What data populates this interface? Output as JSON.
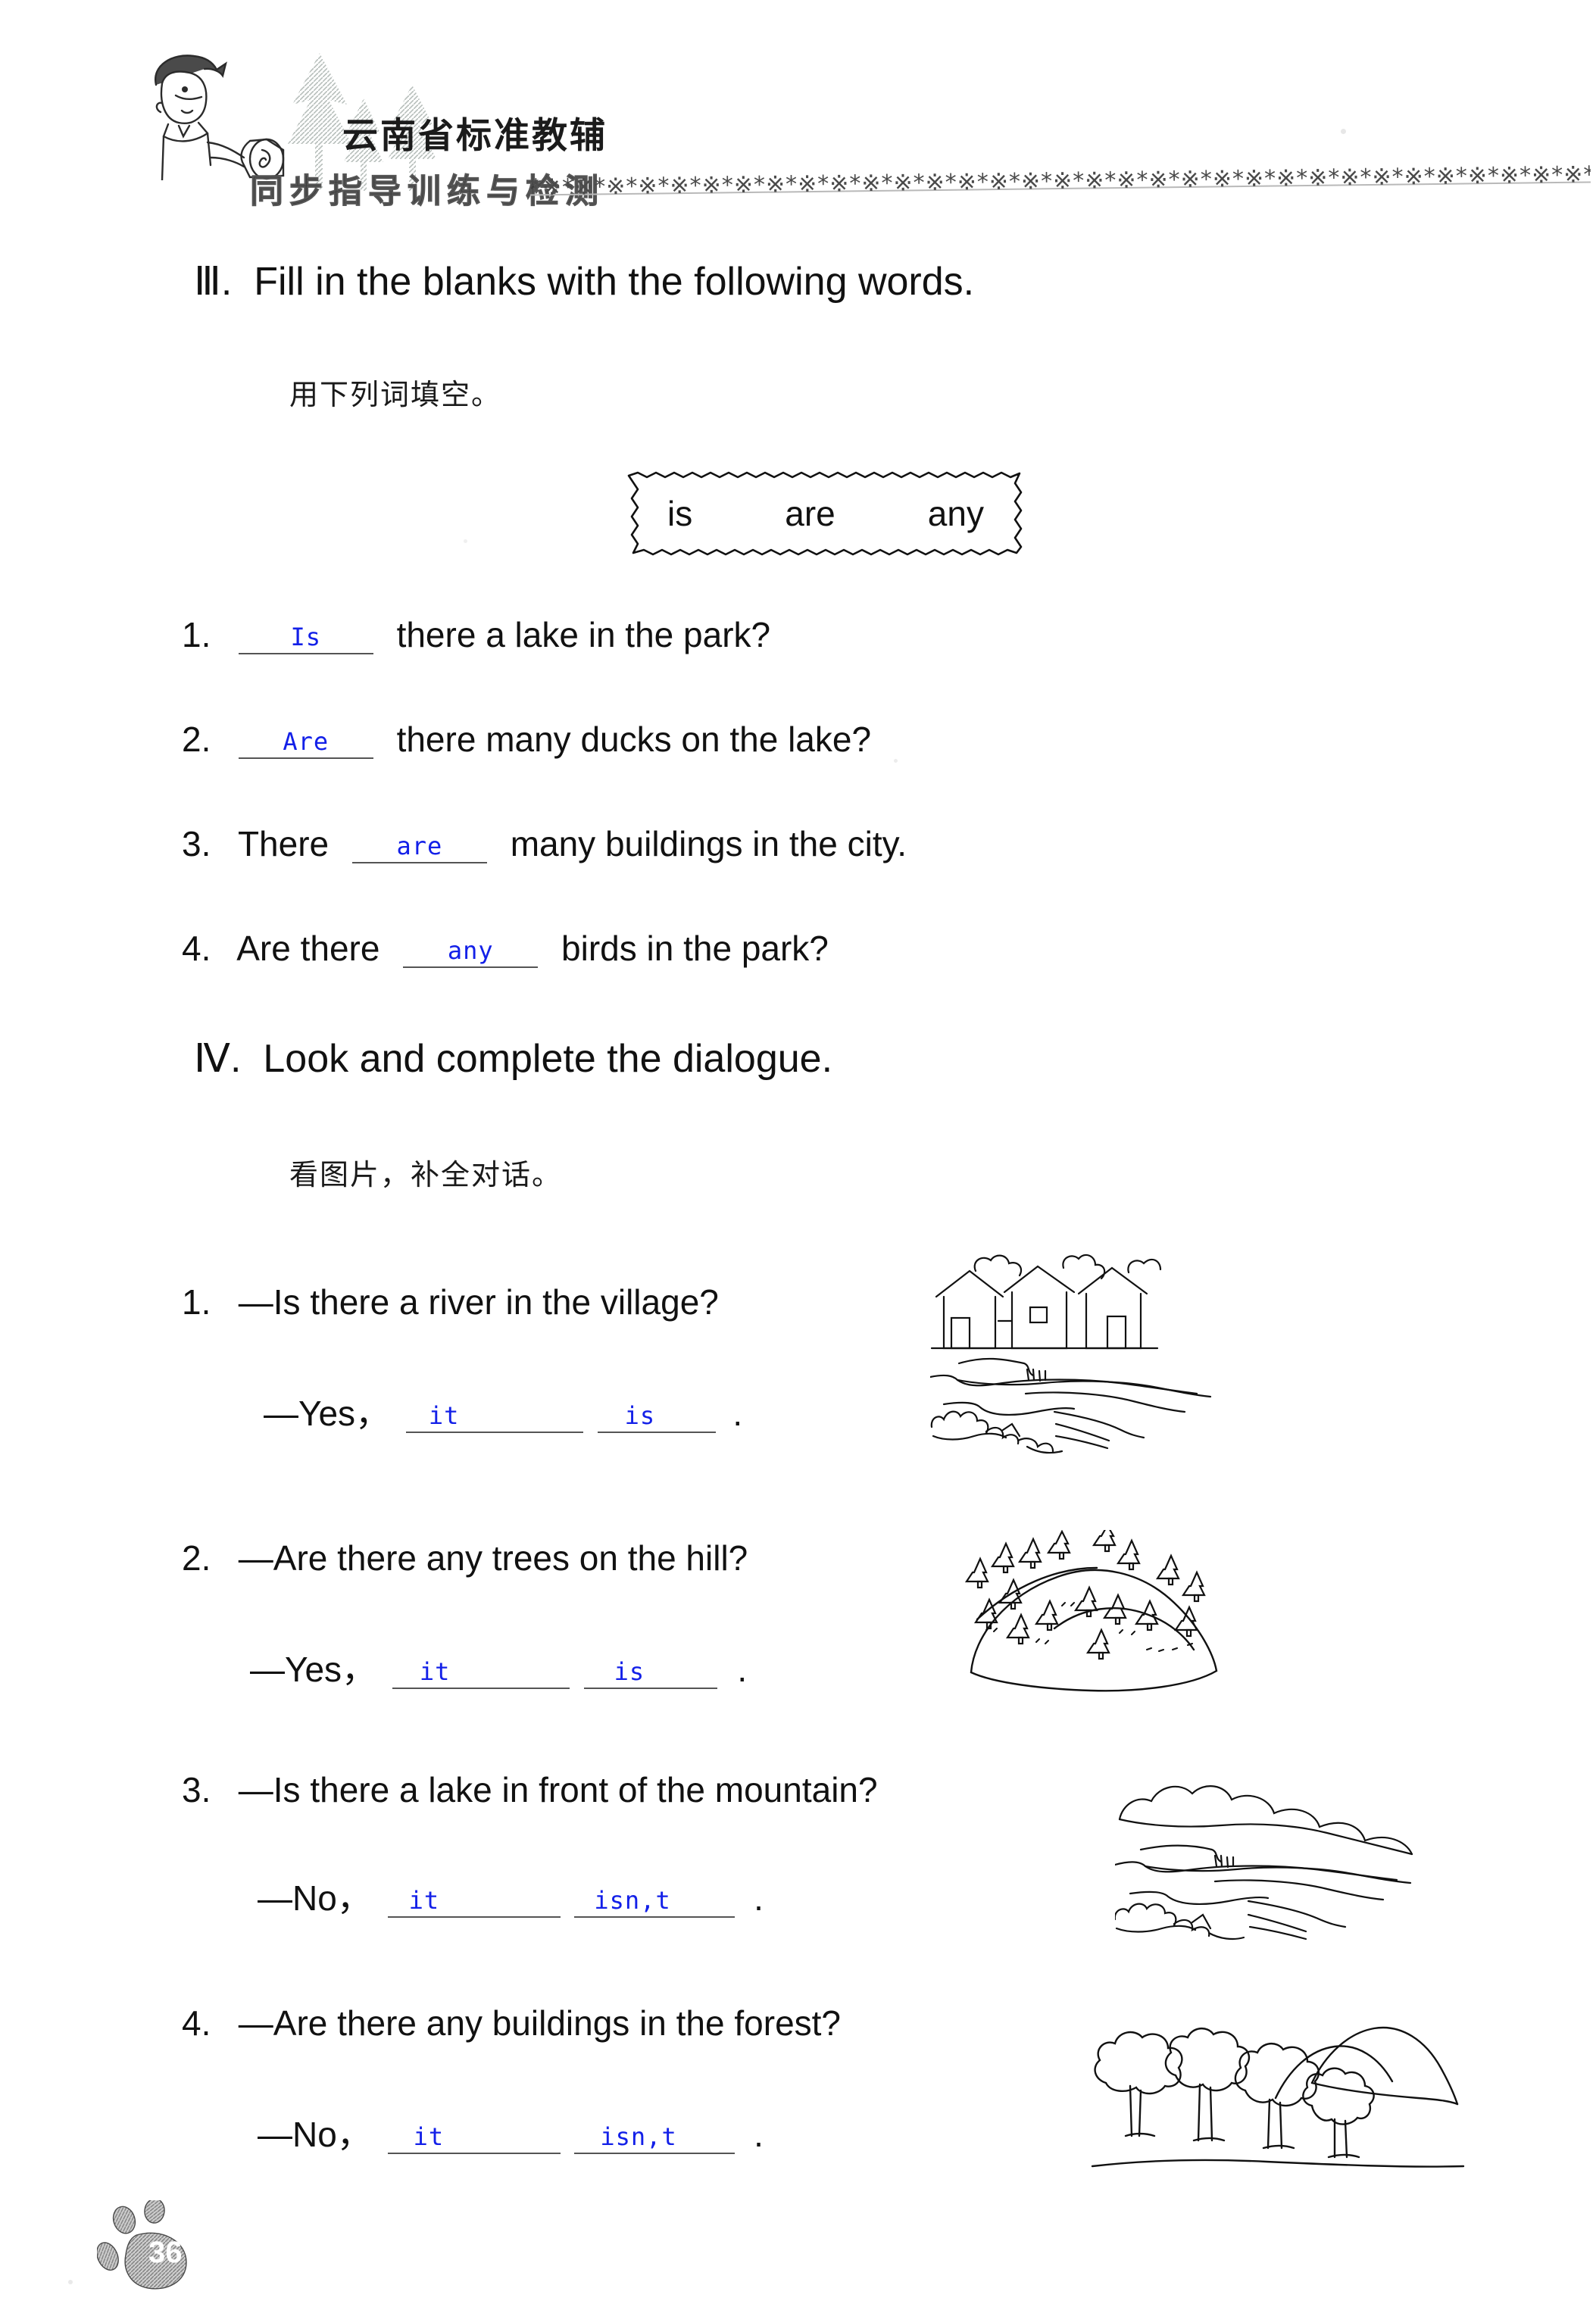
{
  "header": {
    "brand_cn": "云南省标准教辅",
    "brand_sub_cn": "同步指导训练与检测",
    "asterisk_band": "*※*※*※*※*※*※*※*※*※*※*※*※*※*※*※*※*※*※*※*※*※*※*※*※*※*※*※*※*※*※*※*※*※*※*※*※*※*",
    "mascot_icon": "boy-with-scroll-icon",
    "trees_icon": "pine-trees-icon"
  },
  "sections": [
    {
      "roman": "Ⅲ",
      "dot": ".",
      "title": "Fill in the blanks with the following words.",
      "instruction_cn": "用下列词填空。",
      "word_bank": [
        "is",
        "are",
        "any"
      ],
      "items": [
        {
          "num": "1.",
          "before": "",
          "answer": "Is",
          "after": "there a lake in the park?"
        },
        {
          "num": "2.",
          "before": "",
          "answer": "Are",
          "after": "there many ducks on the lake?"
        },
        {
          "num": "3.",
          "before": "There",
          "answer": "are",
          "after": "many buildings in the city."
        },
        {
          "num": "4.",
          "before": "Are there",
          "answer": "any",
          "after": "birds in the park?"
        }
      ]
    },
    {
      "roman": "Ⅳ",
      "dot": ".",
      "title": "Look and complete the dialogue.",
      "instruction_cn": "看图片，补全对话。",
      "items": [
        {
          "num": "1.",
          "question": "—Is there a river in the village?",
          "answer_lead": "—Yes，",
          "answer_1": "it",
          "answer_2": "is",
          "period": ".",
          "picture": "village-with-river-icon"
        },
        {
          "num": "2.",
          "question": "—Are there any trees on the hill?",
          "answer_lead": "—Yes，",
          "answer_1": "it",
          "answer_2": "is",
          "period": ".",
          "picture": "hill-with-trees-icon"
        },
        {
          "num": "3.",
          "question": "—Is there a lake in front of the mountain?",
          "answer_lead": "—No，",
          "answer_1": "it",
          "answer_2": "isn,t",
          "period": ".",
          "picture": "mountain-with-lake-icon"
        },
        {
          "num": "4.",
          "question": "—Are there any buildings in the forest?",
          "answer_lead": "—No，",
          "answer_1": "it",
          "answer_2": "isn,t",
          "period": ".",
          "picture": "forest-with-hills-icon"
        }
      ]
    }
  ],
  "footer": {
    "page_number": "36",
    "paw_icon": "paw-print-icon"
  },
  "colors": {
    "handwriting": "#1320e8",
    "rule": "#555555",
    "ink": "#111111"
  }
}
